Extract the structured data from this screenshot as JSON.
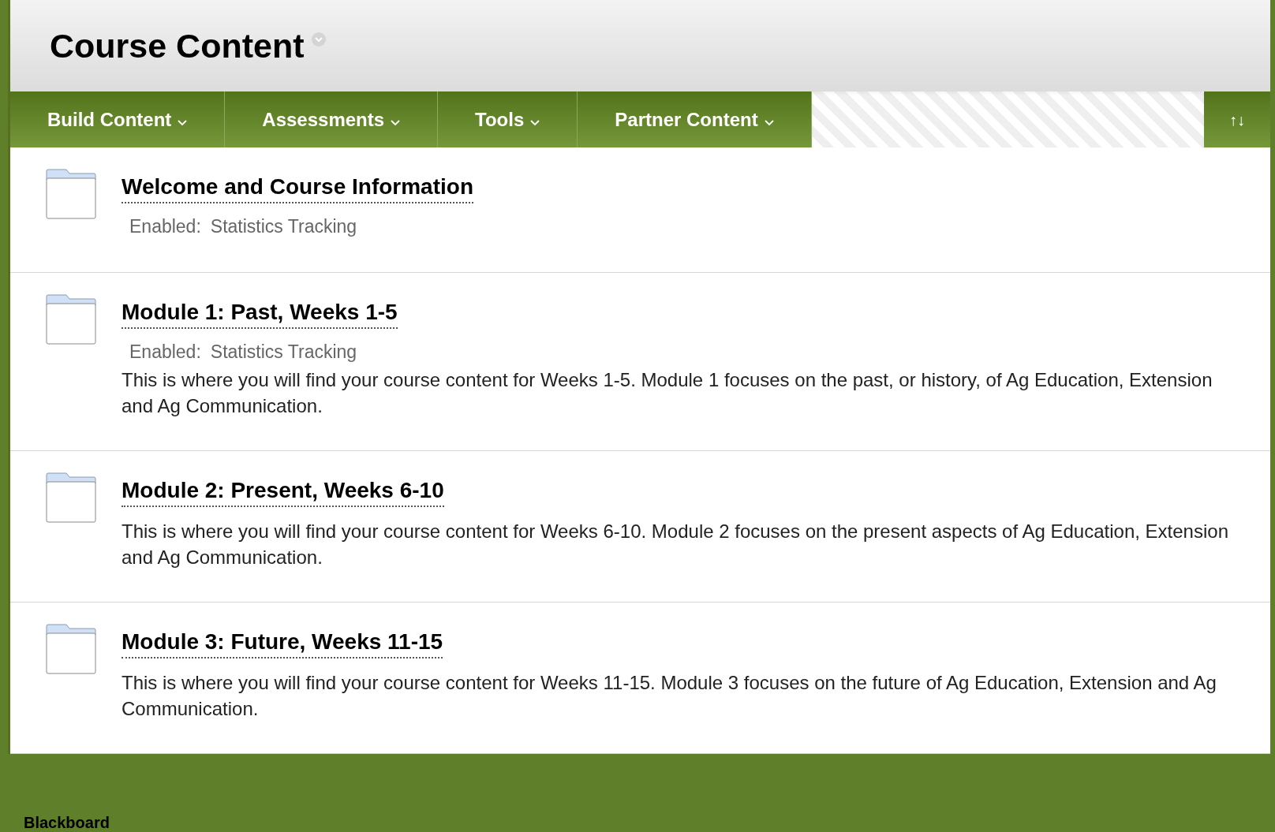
{
  "page_title": "Course Content",
  "menu": [
    {
      "label": "Build Content"
    },
    {
      "label": "Assessments"
    },
    {
      "label": "Tools"
    },
    {
      "label": "Partner Content"
    }
  ],
  "sort_button": {
    "label": "↑↓"
  },
  "items": [
    {
      "title": "Welcome and Course Information",
      "enabled_label": "Enabled:",
      "enabled_value": "Statistics Tracking"
    },
    {
      "title": "Module 1: Past, Weeks 1-5",
      "enabled_label": "Enabled:",
      "enabled_value": "Statistics Tracking",
      "description": "This is where you will find your course content for Weeks 1-5.  Module 1 focuses on the past, or history, of Ag Education, Extension and Ag Communication."
    },
    {
      "title": "Module 2: Present, Weeks 6-10",
      "description": "This is where you will find your course content for Weeks 6-10.  Module 2 focuses on the present aspects of Ag Education, Extension and Ag Communication."
    },
    {
      "title": "Module 3: Future, Weeks 11-15",
      "description": "This is where you will find your course content for Weeks 11-15.  Module 3 focuses on the future of Ag Education, Extension and Ag Communication."
    }
  ],
  "footer": {
    "brand": "Blackboard"
  }
}
